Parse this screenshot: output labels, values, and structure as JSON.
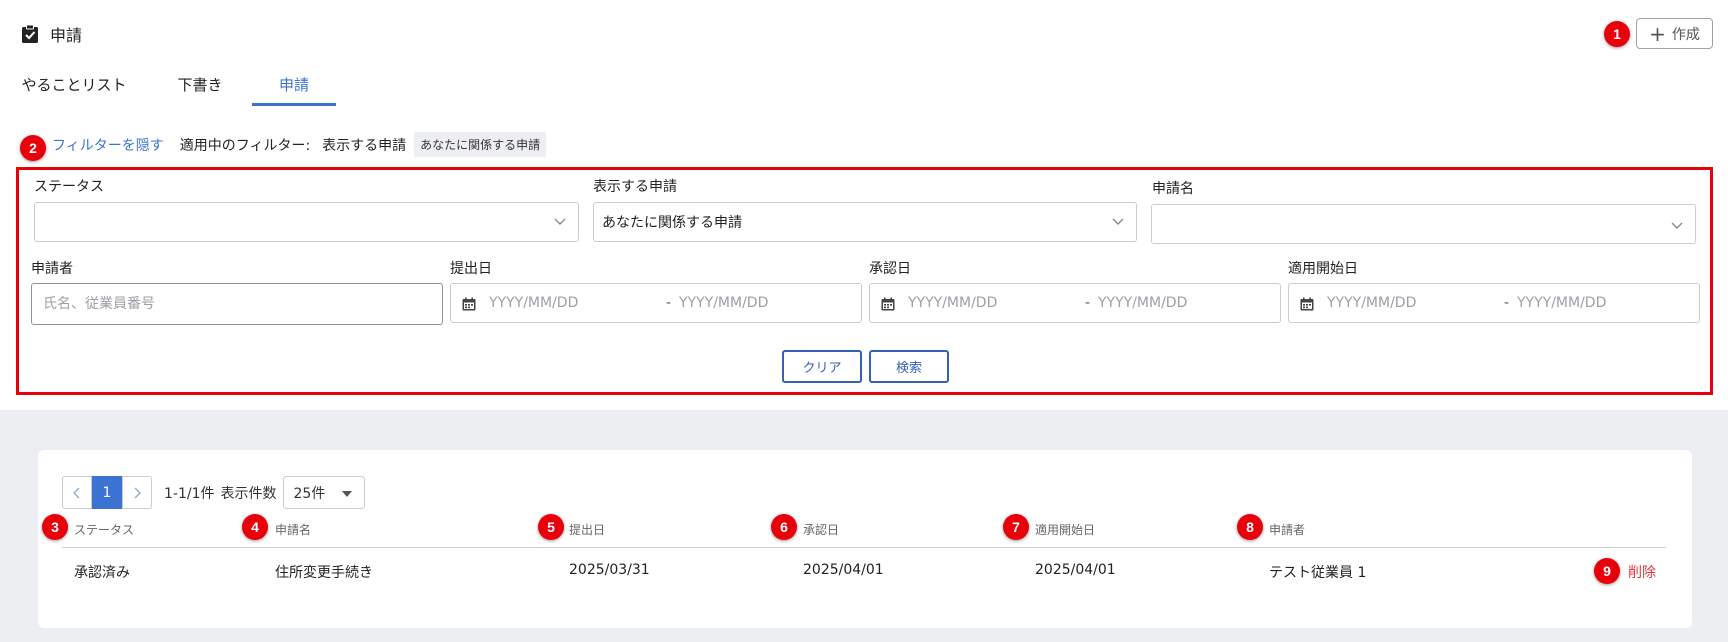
{
  "header": {
    "title": "申請",
    "create_label": "作成"
  },
  "tabs": [
    {
      "label": "やることリスト",
      "active": false
    },
    {
      "label": "下書き",
      "active": false
    },
    {
      "label": "申請",
      "active": true
    }
  ],
  "filter_bar": {
    "hide_label": "フィルターを隠す",
    "applied_label": "適用中のフィルター:",
    "applied_key": "表示する申請",
    "applied_value": "あなたに関係する申請"
  },
  "filters": {
    "status_label": "ステータス",
    "status_value": "",
    "scope_label": "表示する申請",
    "scope_value": "あなたに関係する申請",
    "name_label": "申請名",
    "name_value": "",
    "applicant_label": "申請者",
    "applicant_placeholder": "氏名、従業員番号",
    "submitted_label": "提出日",
    "approved_label": "承認日",
    "effective_label": "適用開始日",
    "date_placeholder": "YYYY/MM/DD",
    "clear_label": "クリア",
    "search_label": "検索"
  },
  "pagination": {
    "current_page": "1",
    "range": "1-1/1件",
    "per_page_label": "表示件数",
    "per_page_value": "25件"
  },
  "table": {
    "columns": [
      "ステータス",
      "申請名",
      "提出日",
      "承認日",
      "適用開始日",
      "申請者"
    ],
    "rows": [
      {
        "status": "承認済み",
        "name": "住所変更手続き",
        "submitted": "2025/03/31",
        "approved": "2025/04/01",
        "effective": "2025/04/01",
        "applicant": "テスト従業員 1",
        "delete_label": "削除"
      }
    ]
  },
  "annotations": [
    "1",
    "2",
    "3",
    "4",
    "5",
    "6",
    "7",
    "8",
    "9"
  ],
  "colors": {
    "accent": "#3b73d2",
    "annotation": "#e8000b",
    "delete": "#e0353a",
    "background": "#eceef1"
  }
}
